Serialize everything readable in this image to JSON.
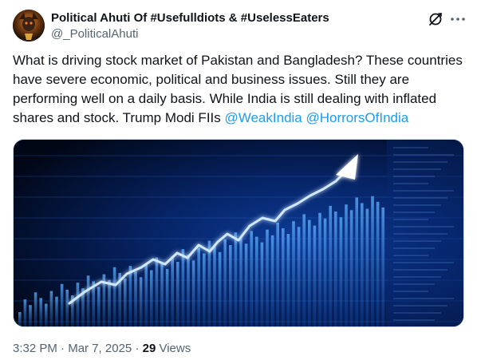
{
  "author": {
    "name": "Political Ahuti Of #Usefulldiots & #UselessEaters",
    "handle": "@_PoliticalAhuti"
  },
  "tweet": {
    "text_part1": "What is driving stock market of Pakistan and Bangladesh? These countries have severe economic, political and business issues. Still they are performing well on a daily basis. While India is still dealing with inflated shares and stock. Trump Modi FIIs ",
    "mention1": "@WeakIndia",
    "mention2": "@HorrorsOfIndia"
  },
  "meta": {
    "time": "3:32 PM",
    "separator": " · ",
    "date": "Mar 7, 2025",
    "views_count": "29",
    "views_label": " Views"
  },
  "icons": {
    "grok": "grok-icon",
    "more": "more-horizontal-icon"
  },
  "colors": {
    "link": "#1d9bf0",
    "secondary_text": "#536471",
    "primary_text": "#0f1419",
    "image_bg": "#020b24",
    "image_glow": "#4aa8ff"
  }
}
